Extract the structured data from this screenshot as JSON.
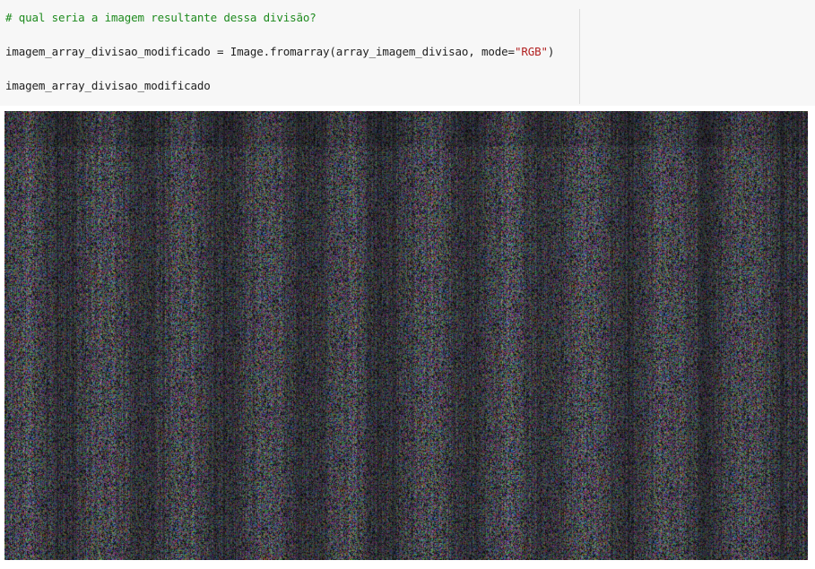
{
  "cell": {
    "comment": "# qual seria a imagem resultante dessa divisão?",
    "line2_prefix": "imagem_array_divisao_modificado = Image.fromarray(array_imagem_divisao, mode=",
    "line2_string": "\"RGB\"",
    "line2_suffix": ")",
    "line3": "imagem_array_divisao_modificado"
  },
  "output_image": {
    "icon": "noise-image",
    "colors": {
      "comment": "#1f8b1f",
      "string": "#b22222",
      "code": "#212121",
      "cell_bg": "#f7f7f7"
    }
  }
}
